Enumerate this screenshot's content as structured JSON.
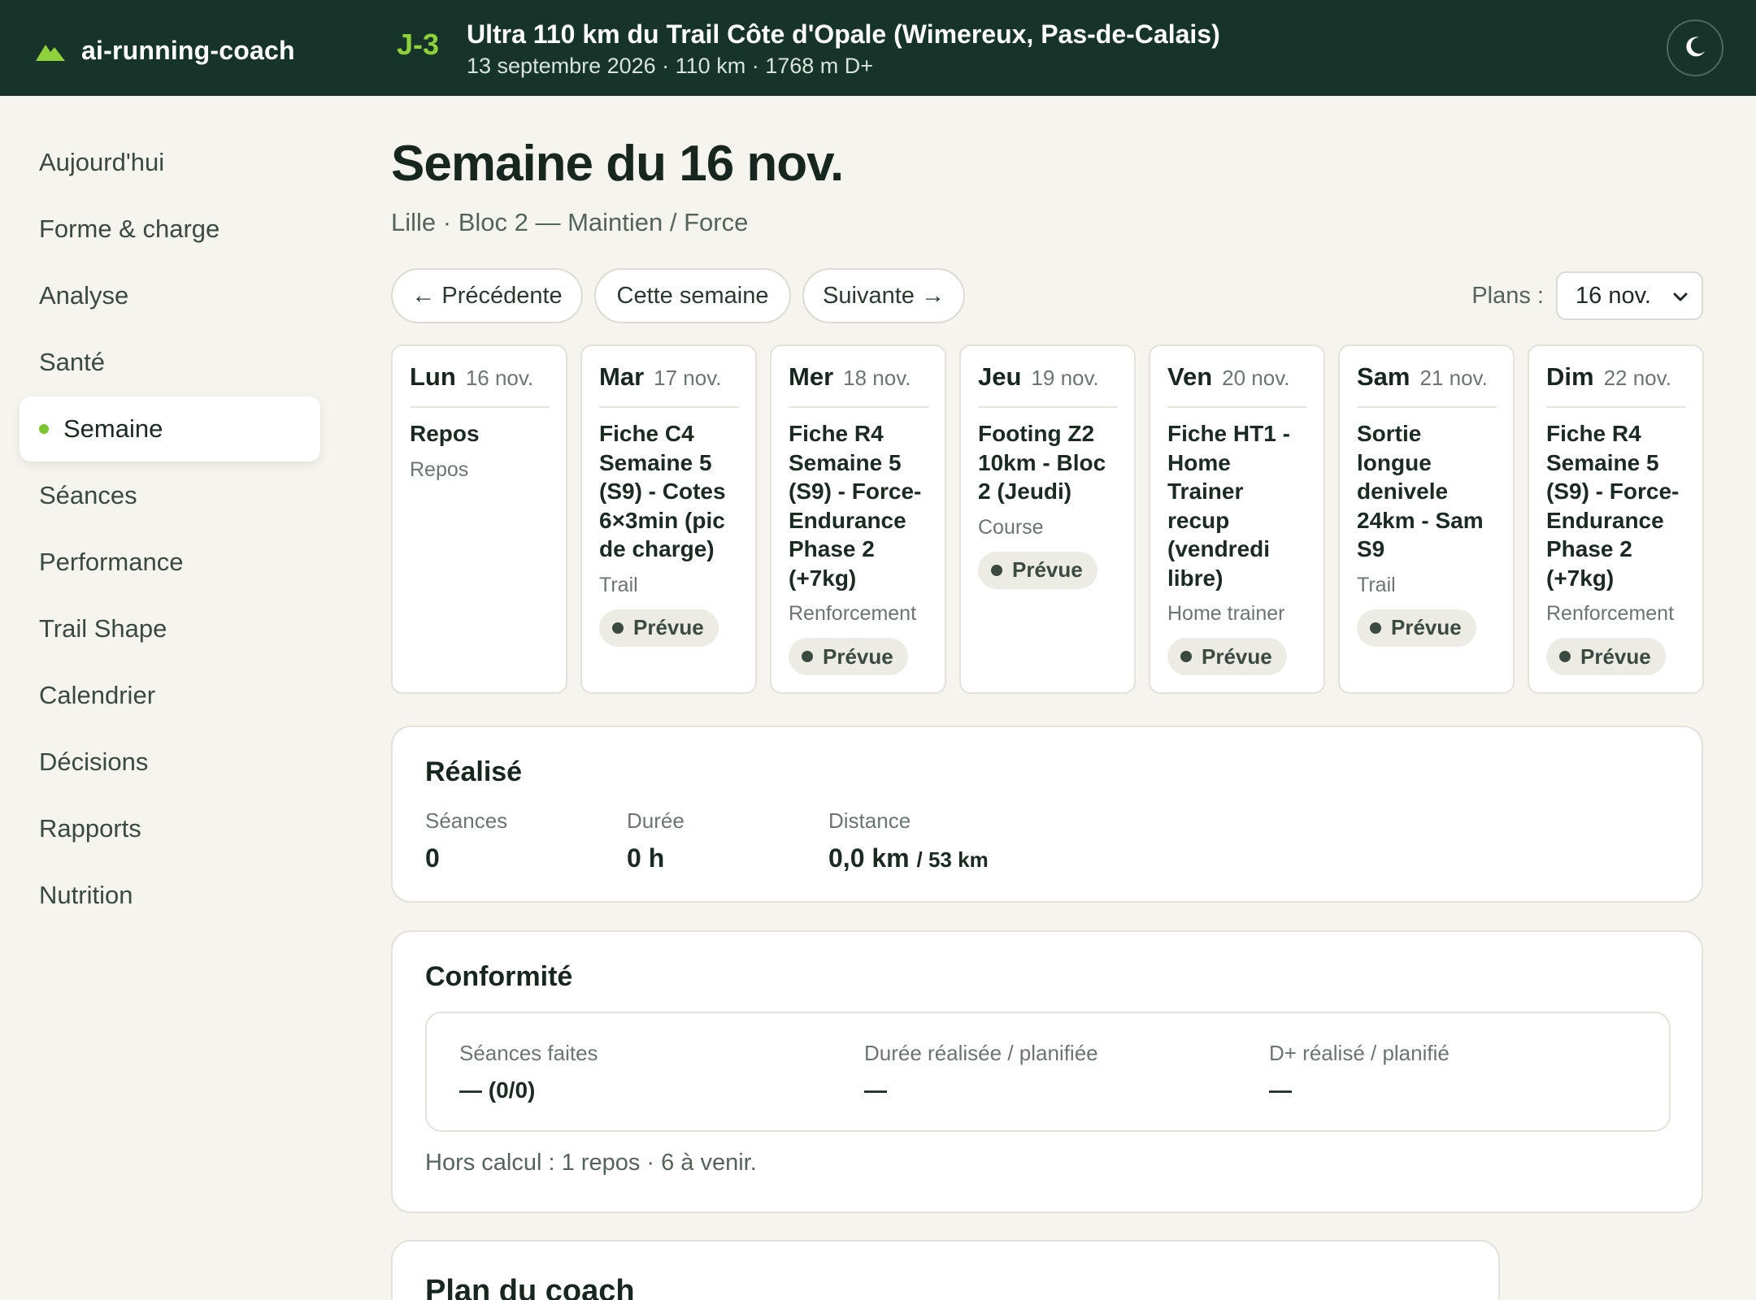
{
  "app": {
    "name": "ai-running-coach"
  },
  "race": {
    "countdown": "J-3",
    "title": "Ultra 110 km du Trail Côte d'Opale (Wimereux, Pas-de-Calais)",
    "subtitle": "13 septembre 2026 · 110 km · 1768 m D+"
  },
  "icons": {
    "logo": "mountain-icon",
    "theme": "moon-icon",
    "select": "chevron-down-icon",
    "status": "dot-icon"
  },
  "colors": {
    "topbar": "#16342a",
    "accent": "#8fd13a",
    "active_dot": "#7cc531",
    "background": "#f5f4ef"
  },
  "sidebar": {
    "items": [
      {
        "label": "Aujourd'hui",
        "active": false
      },
      {
        "label": "Forme & charge",
        "active": false
      },
      {
        "label": "Analyse",
        "active": false
      },
      {
        "label": "Santé",
        "active": false
      },
      {
        "label": "Semaine",
        "active": true
      },
      {
        "label": "Séances",
        "active": false
      },
      {
        "label": "Performance",
        "active": false
      },
      {
        "label": "Trail Shape",
        "active": false
      },
      {
        "label": "Calendrier",
        "active": false
      },
      {
        "label": "Décisions",
        "active": false
      },
      {
        "label": "Rapports",
        "active": false
      },
      {
        "label": "Nutrition",
        "active": false
      }
    ]
  },
  "page": {
    "title": "Semaine du 16 nov.",
    "subtitle": "Lille · Bloc 2 — Maintien / Force"
  },
  "toolbar": {
    "prev": "← Précédente",
    "current": "Cette semaine",
    "next": "Suivante →",
    "plans_label": "Plans :",
    "plans_value": "16 nov."
  },
  "days": [
    {
      "name": "Lun",
      "date": "16 nov.",
      "title": "Repos",
      "type": "Repos",
      "status": ""
    },
    {
      "name": "Mar",
      "date": "17 nov.",
      "title": "Fiche C4 Semaine 5 (S9) - Cotes 6×3min (pic de charge)",
      "type": "Trail",
      "status": "Prévue"
    },
    {
      "name": "Mer",
      "date": "18 nov.",
      "title": "Fiche R4 Semaine 5 (S9) - Force-Endurance Phase 2 (+7kg)",
      "type": "Renforcement",
      "status": "Prévue"
    },
    {
      "name": "Jeu",
      "date": "19 nov.",
      "title": "Footing Z2 10km - Bloc 2 (Jeudi)",
      "type": "Course",
      "status": "Prévue"
    },
    {
      "name": "Ven",
      "date": "20 nov.",
      "title": "Fiche HT1 - Home Trainer recup (vendredi libre)",
      "type": "Home trainer",
      "status": "Prévue"
    },
    {
      "name": "Sam",
      "date": "21 nov.",
      "title": "Sortie longue denivele 24km - Sam S9",
      "type": "Trail",
      "status": "Prévue"
    },
    {
      "name": "Dim",
      "date": "22 nov.",
      "title": "Fiche R4 Semaine 5 (S9) - Force-Endurance Phase 2 (+7kg)",
      "type": "Renforcement",
      "status": "Prévue"
    }
  ],
  "realise": {
    "title": "Réalisé",
    "seances_label": "Séances",
    "seances_value": "0",
    "duree_label": "Durée",
    "duree_value": "0 h",
    "distance_label": "Distance",
    "distance_value": "0,0 km",
    "distance_target": "/ 53 km"
  },
  "conformite": {
    "title": "Conformité",
    "faites_label": "Séances faites",
    "faites_value": "— (0/0)",
    "duree_label": "Durée réalisée / planifiée",
    "duree_value": "—",
    "dplus_label": "D+ réalisé / planifié",
    "dplus_value": "—",
    "note": "Hors calcul : 1 repos · 6 à venir."
  },
  "plan_coach": {
    "title": "Plan du coach"
  }
}
